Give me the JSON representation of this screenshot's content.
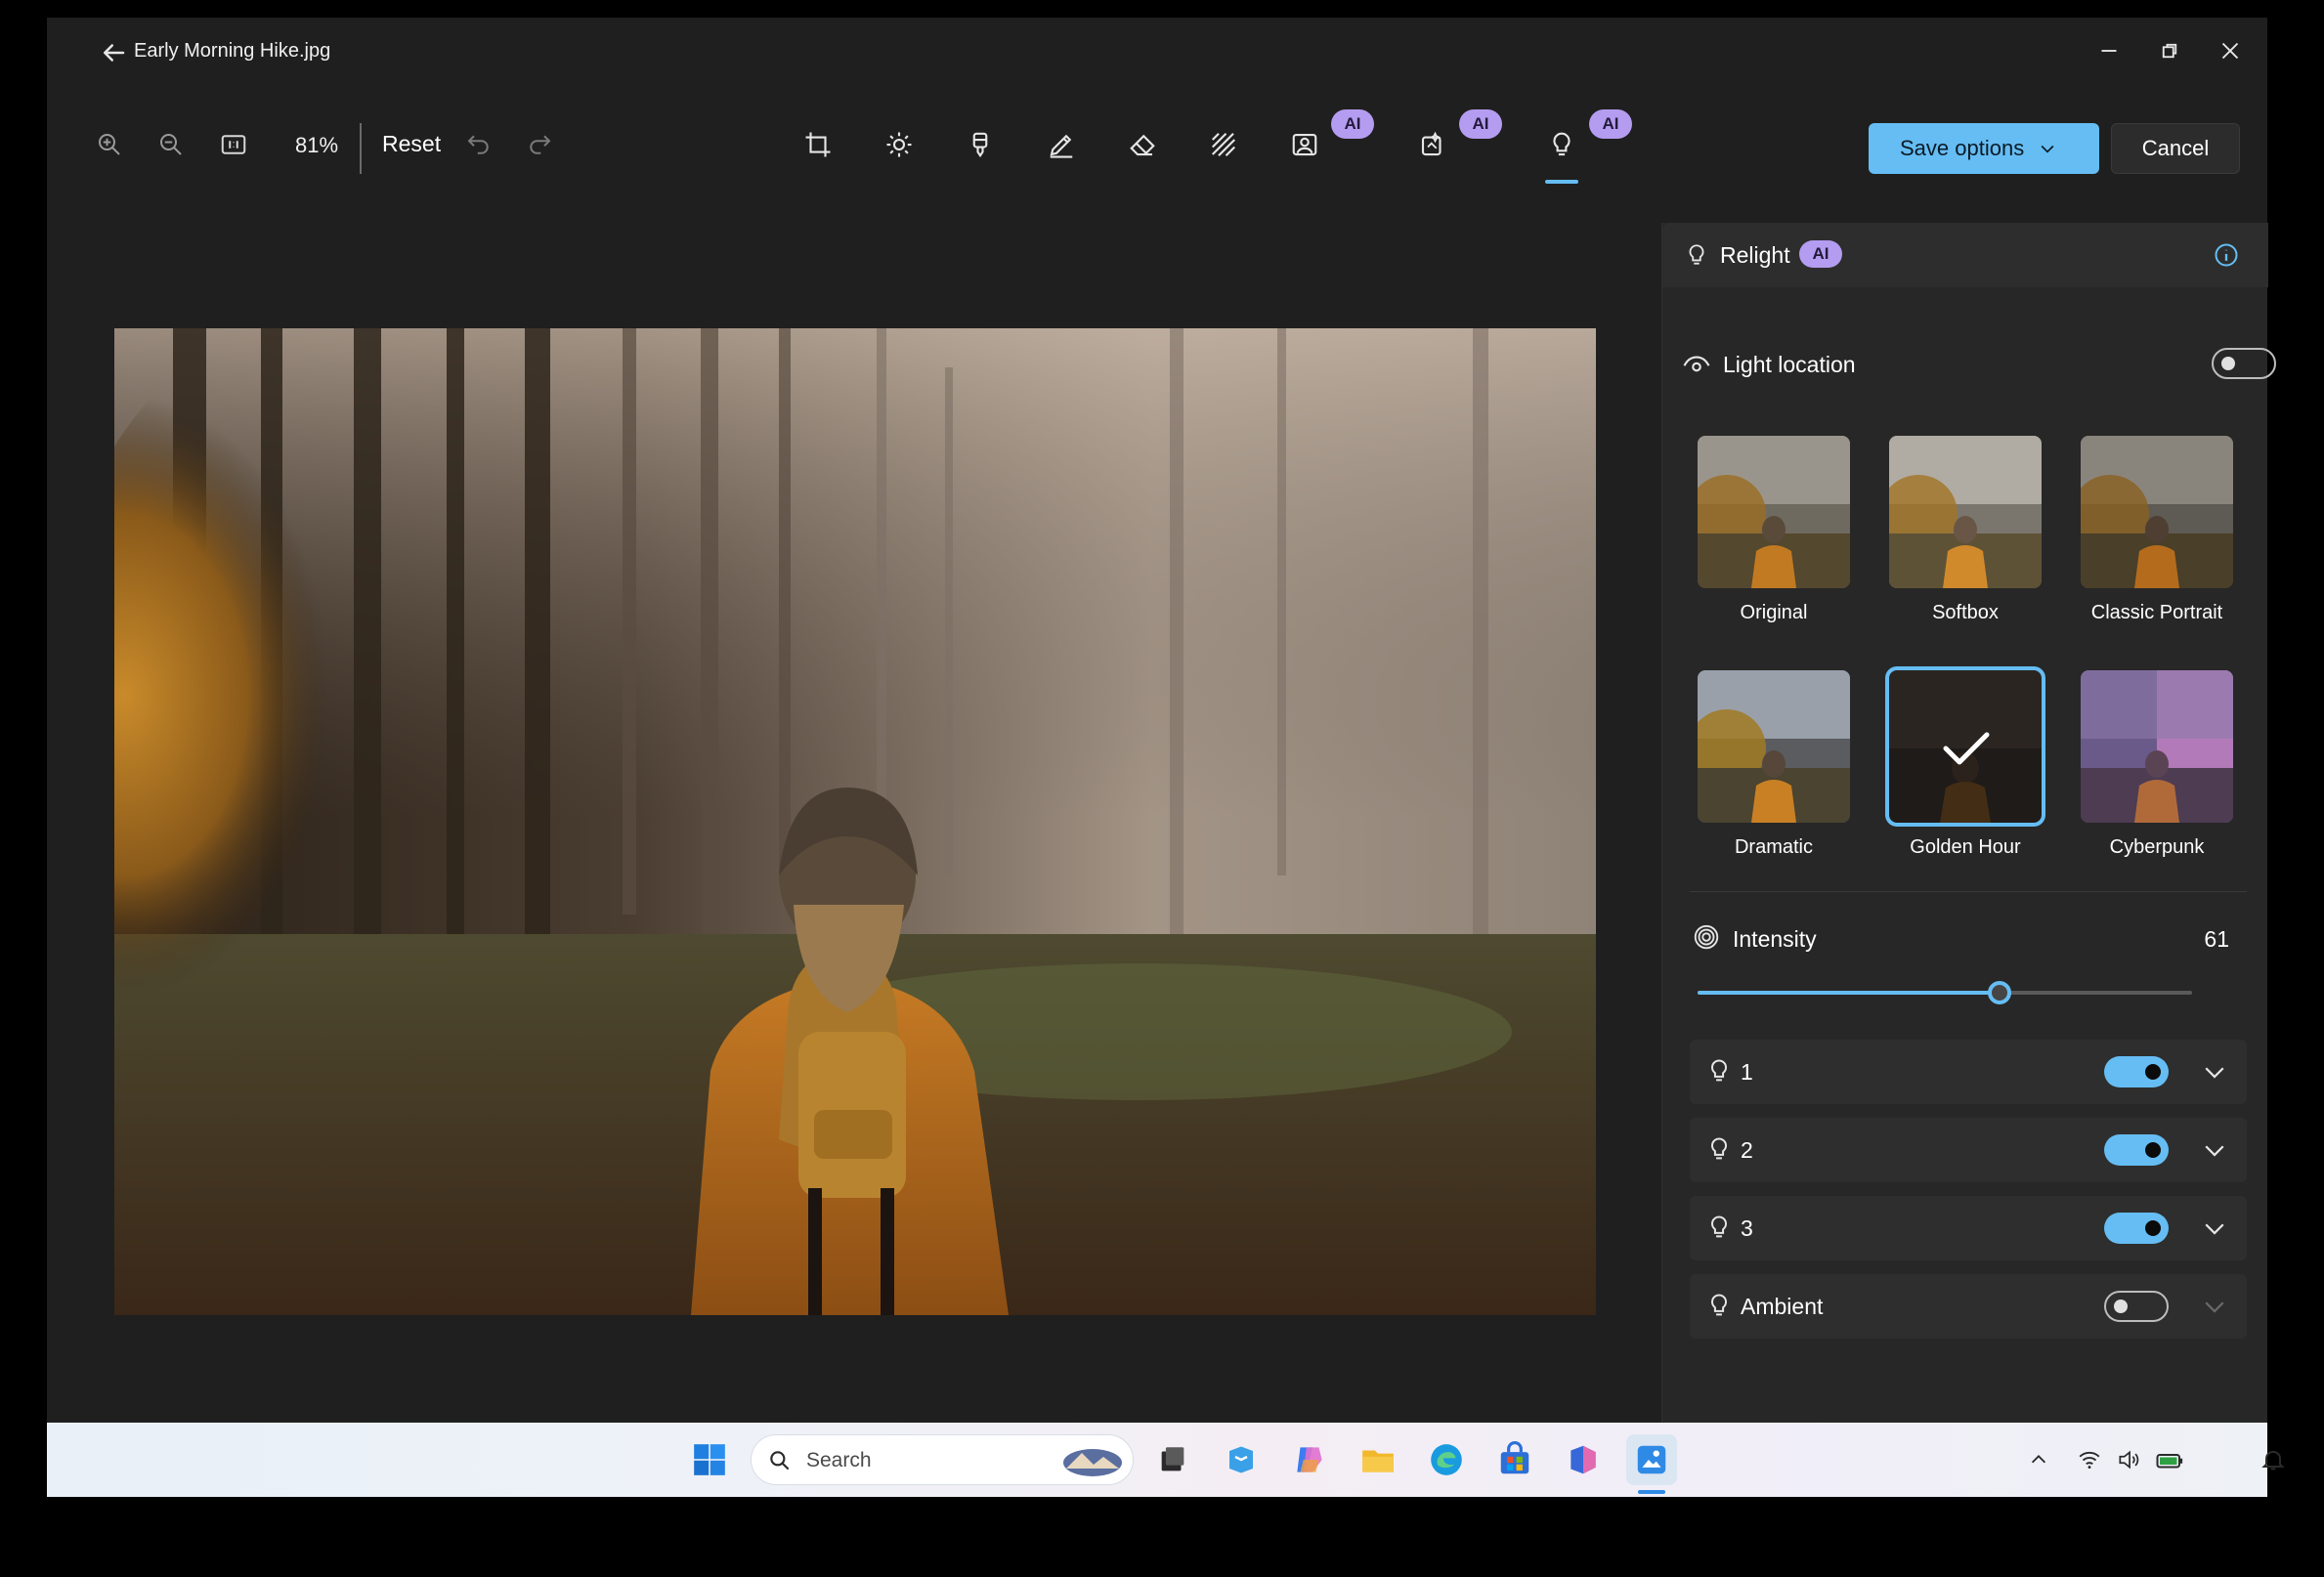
{
  "window": {
    "title": "Early Morning Hike.jpg",
    "controls": {
      "minimize": "minimize",
      "maximize": "restore",
      "close": "close"
    }
  },
  "toolbar": {
    "zoom_level": "81%",
    "reset_label": "Reset",
    "ai_badge": "AI",
    "tools": [
      "crop-icon",
      "brightness-icon",
      "markup-icon",
      "draw-icon",
      "erase-icon",
      "background-blur-icon",
      "remove-background-icon",
      "generative-fill-icon",
      "relight-icon"
    ],
    "save_label": "Save options",
    "cancel_label": "Cancel"
  },
  "panel": {
    "title": "Relight",
    "ai_badge": "AI",
    "light_location_label": "Light location",
    "light_location_on": false,
    "presets": [
      {
        "label": "Original",
        "selected": false
      },
      {
        "label": "Softbox",
        "selected": false
      },
      {
        "label": "Classic Portrait",
        "selected": false
      },
      {
        "label": "Dramatic",
        "selected": false
      },
      {
        "label": "Golden Hour",
        "selected": true
      },
      {
        "label": "Cyberpunk",
        "selected": false
      }
    ],
    "intensity": {
      "label": "Intensity",
      "value": "61"
    },
    "lights": [
      {
        "label": "1",
        "on": true
      },
      {
        "label": "2",
        "on": true
      },
      {
        "label": "3",
        "on": true
      },
      {
        "label": "Ambient",
        "on": false
      }
    ]
  },
  "taskbar": {
    "search_placeholder": "Search",
    "apps": [
      "start-icon",
      "task-view-icon",
      "store-icon",
      "copilot-icon",
      "file-explorer-icon",
      "edge-icon",
      "microsoft-store-icon",
      "m365-icon",
      "photos-icon"
    ]
  },
  "colors": {
    "accent": "#65bdf3",
    "ai_badge": "#b49cf0",
    "panel_bg": "#272727",
    "window_bg": "#1f1f1f"
  }
}
